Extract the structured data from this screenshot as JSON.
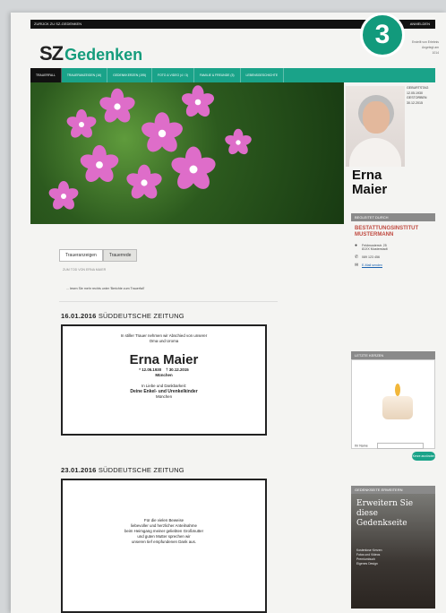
{
  "topbar": {
    "left": "ZURÜCK ZU SZ-GEDENKEN",
    "right": "ANMELDEN"
  },
  "badge": "3",
  "logo": {
    "sz": "SZ",
    "word": "Gedenken"
  },
  "top_right": {
    "line1": "Erstellt von Erlebnis",
    "line2": "Angelegt am",
    "line3": "1014"
  },
  "nav": [
    "TRAUERFALL",
    "TRAUERANZEIGEN (16)",
    "GEDENKKERZEN (195)",
    "FOTO & VIDEO (4 / 3)",
    "FAMILIE & FREUNDE (3)",
    "LEBENSGESCHICHTE"
  ],
  "deceased": {
    "name_first": "Erna",
    "name_last": "Maier",
    "born_label": "GEBURTSTAG",
    "born": "12.05.1930",
    "died_label": "GESTORBEN",
    "died": "30.12.2015"
  },
  "bestatter": {
    "header": "BEGLEITET DURCH",
    "title_line1": "BESTATTUNGSINSTITUT",
    "title_line2": "MUSTERMANN",
    "address1": "Feldmusterstr. 25",
    "address2": "81XX Musterstadt",
    "phone": "089 123 456",
    "email": "E-Mail senden"
  },
  "kerzen": {
    "header": "LETZTE KERZEN",
    "name_label": "Ihr Name",
    "button": "Kerze anzünden"
  },
  "erweitern": {
    "header": "GEDENKSEITE ERWEITERN",
    "title1": "Erweitern Sie",
    "title2": "diese Gedenkseite",
    "lines": [
      "Kostenlose Kerzen",
      "Fotos und Videos",
      "Premiumbuch",
      "Eigenes Design"
    ]
  },
  "tabs": [
    "Traueranzeigen",
    "Trauerrede"
  ],
  "breadcrumb": "ZUM TOD VON ERNA MAIER",
  "lead": "... lesen Sie mehr rechts unter 'Berichte zum Trauerfall'",
  "notices": [
    {
      "date": "16.01.2016",
      "paper": "SÜDDEUTSCHE ZEITUNG",
      "intro1": "In stiller Trauer nehmen wir Abschied von unserer",
      "intro2": "Oma und Uroma",
      "name": "Erna Maier",
      "born": "* 12.05.1930",
      "died": "† 30.12.2015",
      "city": "München",
      "closing1": "In Liebe und Dankbarkeit:",
      "closing2": "Deine Enkel- und Urenkelkinder",
      "closing3": "München"
    },
    {
      "date": "23.01.2016",
      "paper": "SÜDDEUTSCHE ZEITUNG",
      "lines": [
        "Für die vielen Beweise",
        "liebevoller und herzlicher Anteilnahme",
        "beim Heimgang meiner geliebten Großmutter",
        "und guten Mutter sprechen wir",
        "unseren tief empfundenen Dank aus."
      ]
    }
  ]
}
